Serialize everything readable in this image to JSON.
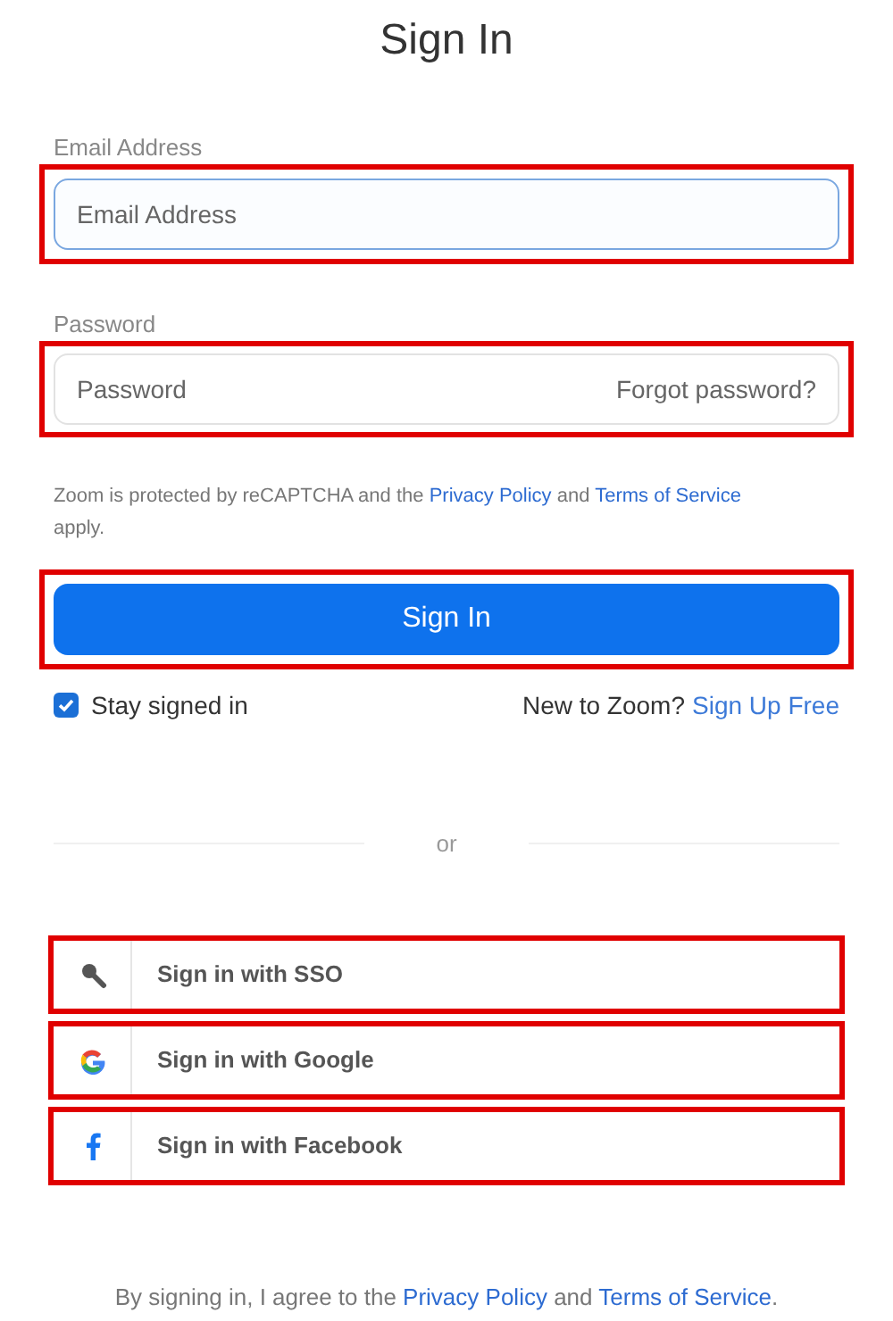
{
  "title": "Sign In",
  "email": {
    "label": "Email Address",
    "placeholder": "Email Address",
    "focused": true,
    "highlighted": true
  },
  "password": {
    "label": "Password",
    "placeholder": "Password",
    "forgot_link": "Forgot password?",
    "focused": false,
    "highlighted": true
  },
  "recaptcha": {
    "before": "Zoom is protected by reCAPTCHA and the",
    "privacy_link": "Privacy Policy",
    "between": "and",
    "terms_link": "Terms of Service",
    "after": "apply."
  },
  "sign_in_button": {
    "label": "Sign In",
    "highlighted": true
  },
  "stay_signed_in": {
    "label": "Stay signed in",
    "checked": true
  },
  "signup": {
    "prompt": "New to Zoom?",
    "link": "Sign Up Free"
  },
  "divider": "or",
  "social_buttons": [
    {
      "kind": "sso",
      "label": "Sign in with SSO",
      "highlighted": true
    },
    {
      "kind": "google",
      "label": "Sign in with Google",
      "highlighted": true
    },
    {
      "kind": "facebook",
      "label": "Sign in with Facebook",
      "highlighted": true
    }
  ],
  "footer": {
    "before": "By signing in, I agree to the",
    "privacy_link": "Privacy Policy",
    "between": "and",
    "terms_link": "Terms of Service",
    "after": "."
  }
}
